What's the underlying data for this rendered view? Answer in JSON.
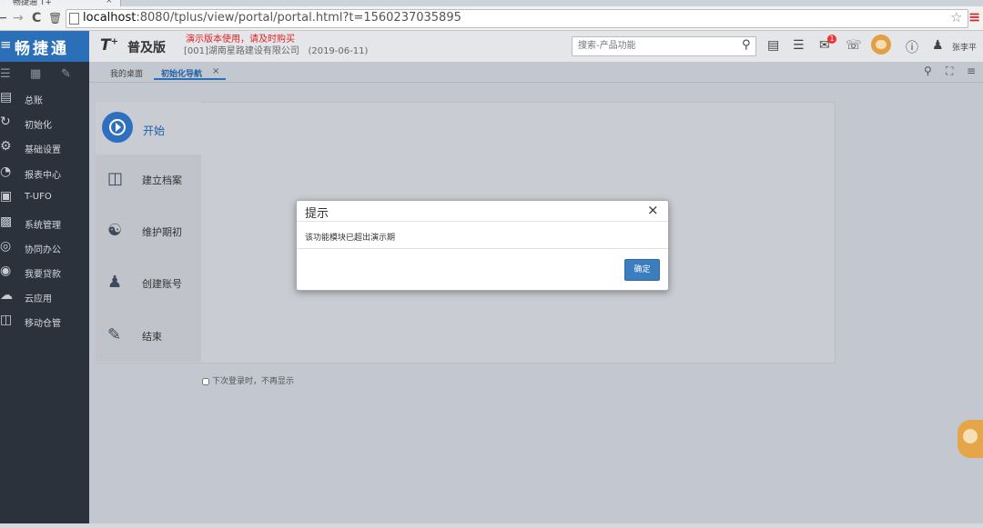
{
  "browser": {
    "tab_title": "畅捷通 T+",
    "tab_close": "×",
    "nav_back": "←",
    "nav_forward": "→",
    "nav_reload": "C",
    "nav_trash": "🗑",
    "url_host": "localhost",
    "url_rest": ":8080/tplus/view/portal/portal.html?t=1560237035895",
    "star": "☆",
    "menu": "≡"
  },
  "header": {
    "brand_menu": "≡",
    "brand_name": "畅捷通",
    "product_logo": "T",
    "product_logo_sup": "+",
    "edition": "普及版",
    "demo_notice": "演示版本使用，请及时购买",
    "company": "[001]湖南星路建设有限公司",
    "date": "(2019-06-11)",
    "search_placeholder": "搜索-产品功能",
    "notification_count": "1",
    "username": "张李平"
  },
  "sidebar": {
    "items": [
      {
        "label": "总账",
        "icon": "ledger-icon"
      },
      {
        "label": "初始化",
        "icon": "init-icon"
      },
      {
        "label": "基础设置",
        "icon": "settings-icon"
      },
      {
        "label": "报表中心",
        "icon": "report-icon"
      },
      {
        "label": "T-UFO",
        "icon": "ufo-icon"
      },
      {
        "label": "系统管理",
        "icon": "system-icon"
      },
      {
        "label": "协同办公",
        "icon": "collab-icon"
      },
      {
        "label": "我要贷款",
        "icon": "loan-icon"
      },
      {
        "label": "云应用",
        "icon": "cloud-icon"
      },
      {
        "label": "移动仓管",
        "icon": "mobile-icon"
      }
    ]
  },
  "tabs": {
    "desktop": "我的桌面",
    "wizard": "初始化导航",
    "close": "×"
  },
  "wizard": {
    "start": "开始",
    "steps": [
      "建立档案",
      "维护期初",
      "创建账号",
      "结束"
    ],
    "dont_show_again": "下次登录时，不再显示"
  },
  "dialog": {
    "title": "提示",
    "close": "×",
    "message": "该功能模块已超出演示期",
    "ok": "确定"
  },
  "colors": {
    "brand": "#2a6fb8",
    "sidebar": "#2b323c",
    "primary_button": "#3b7dbf",
    "demo_notice": "#dd2222"
  }
}
